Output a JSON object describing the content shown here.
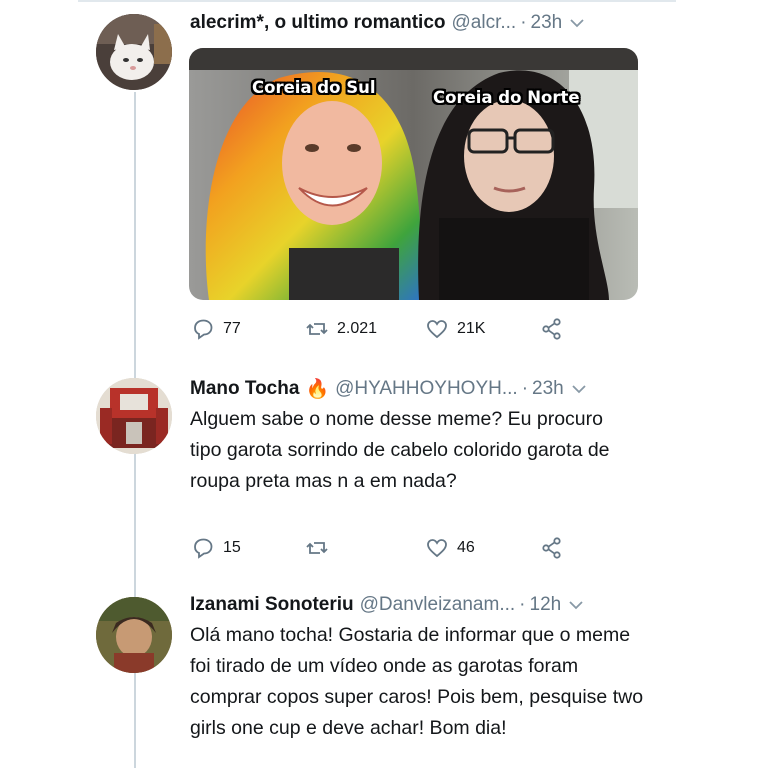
{
  "tweets": [
    {
      "name": "alecrim*, o ultimo romantico",
      "handle": "@alcr...",
      "dot": "·",
      "time": "23h",
      "media_labels": [
        "Coreia do Sul",
        "Coreia do Norte"
      ],
      "replies": "77",
      "retweets": "2.021",
      "likes": "21K"
    },
    {
      "name": "Mano Tocha",
      "name_emoji": "🔥",
      "handle": "@HYAHHOYHOYH...",
      "dot": "·",
      "time": "23h",
      "text": "Alguem sabe o nome desse meme? Eu procuro tipo garota sorrindo de cabelo colorido garota de roupa preta mas n a em nada?",
      "replies": "15",
      "retweets": "",
      "likes": "46"
    },
    {
      "name": "Izanami Sonoteriu",
      "handle": "@Danvleizanam...",
      "dot": "·",
      "time": "12h",
      "text": "Olá mano tocha! Gostaria de informar que o meme foi tirado de um vídeo onde as garotas foram comprar copos super caros! Pois bem, pesquise two girls one cup e deve achar! Bom dia!"
    }
  ],
  "colors": {
    "text": "#14171a",
    "muted": "#657786",
    "thread_line": "#ccd6dd",
    "icon": "#657786"
  }
}
